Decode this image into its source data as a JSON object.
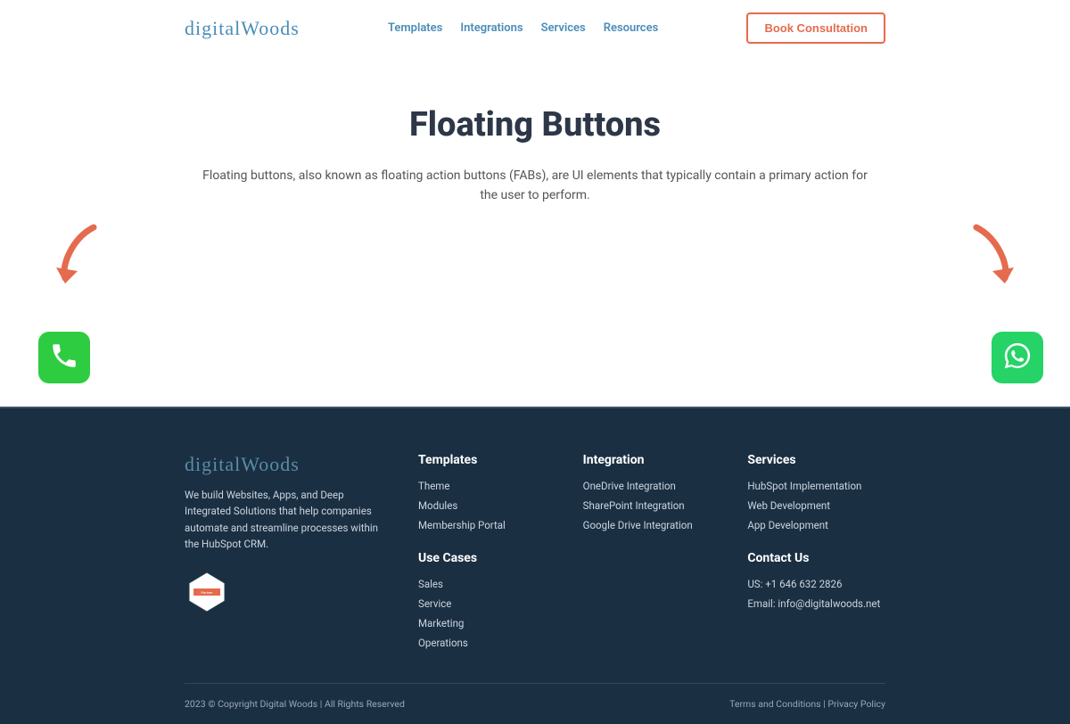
{
  "brand": "digitalWoods",
  "nav": {
    "items": [
      "Templates",
      "Integrations",
      "Services",
      "Resources"
    ],
    "cta": "Book Consultation"
  },
  "hero": {
    "title": "Floating Buttons",
    "description": "Floating buttons, also known as floating action buttons (FABs), are UI elements that typically contain a primary action for the user to perform."
  },
  "footer": {
    "about": "We build Websites, Apps, and Deep Integrated Solutions that help companies automate and streamline processes within the HubSpot CRM.",
    "columns": {
      "templates": {
        "title": "Templates",
        "items": [
          "Theme",
          "Modules",
          "Membership Portal"
        ]
      },
      "usecases": {
        "title": "Use Cases",
        "items": [
          "Sales",
          "Service",
          "Marketing",
          "Operations"
        ]
      },
      "integration": {
        "title": "Integration",
        "items": [
          "OneDrive Integration",
          "SharePoint Integration",
          "Google Drive Integration"
        ]
      },
      "services": {
        "title": "Services",
        "items": [
          "HubSpot Implementation",
          "Web Development",
          "App Development"
        ]
      },
      "contact": {
        "title": "Contact Us",
        "phone": "US: +1 646 632 2826",
        "email": "Email: info@digitalwoods.net"
      }
    },
    "copyright": "2023 © Copyright Digital Woods | All Rights Reserved",
    "legal": {
      "terms": "Terms and Conditions",
      "sep": " | ",
      "privacy": "Privacy Policy"
    }
  }
}
